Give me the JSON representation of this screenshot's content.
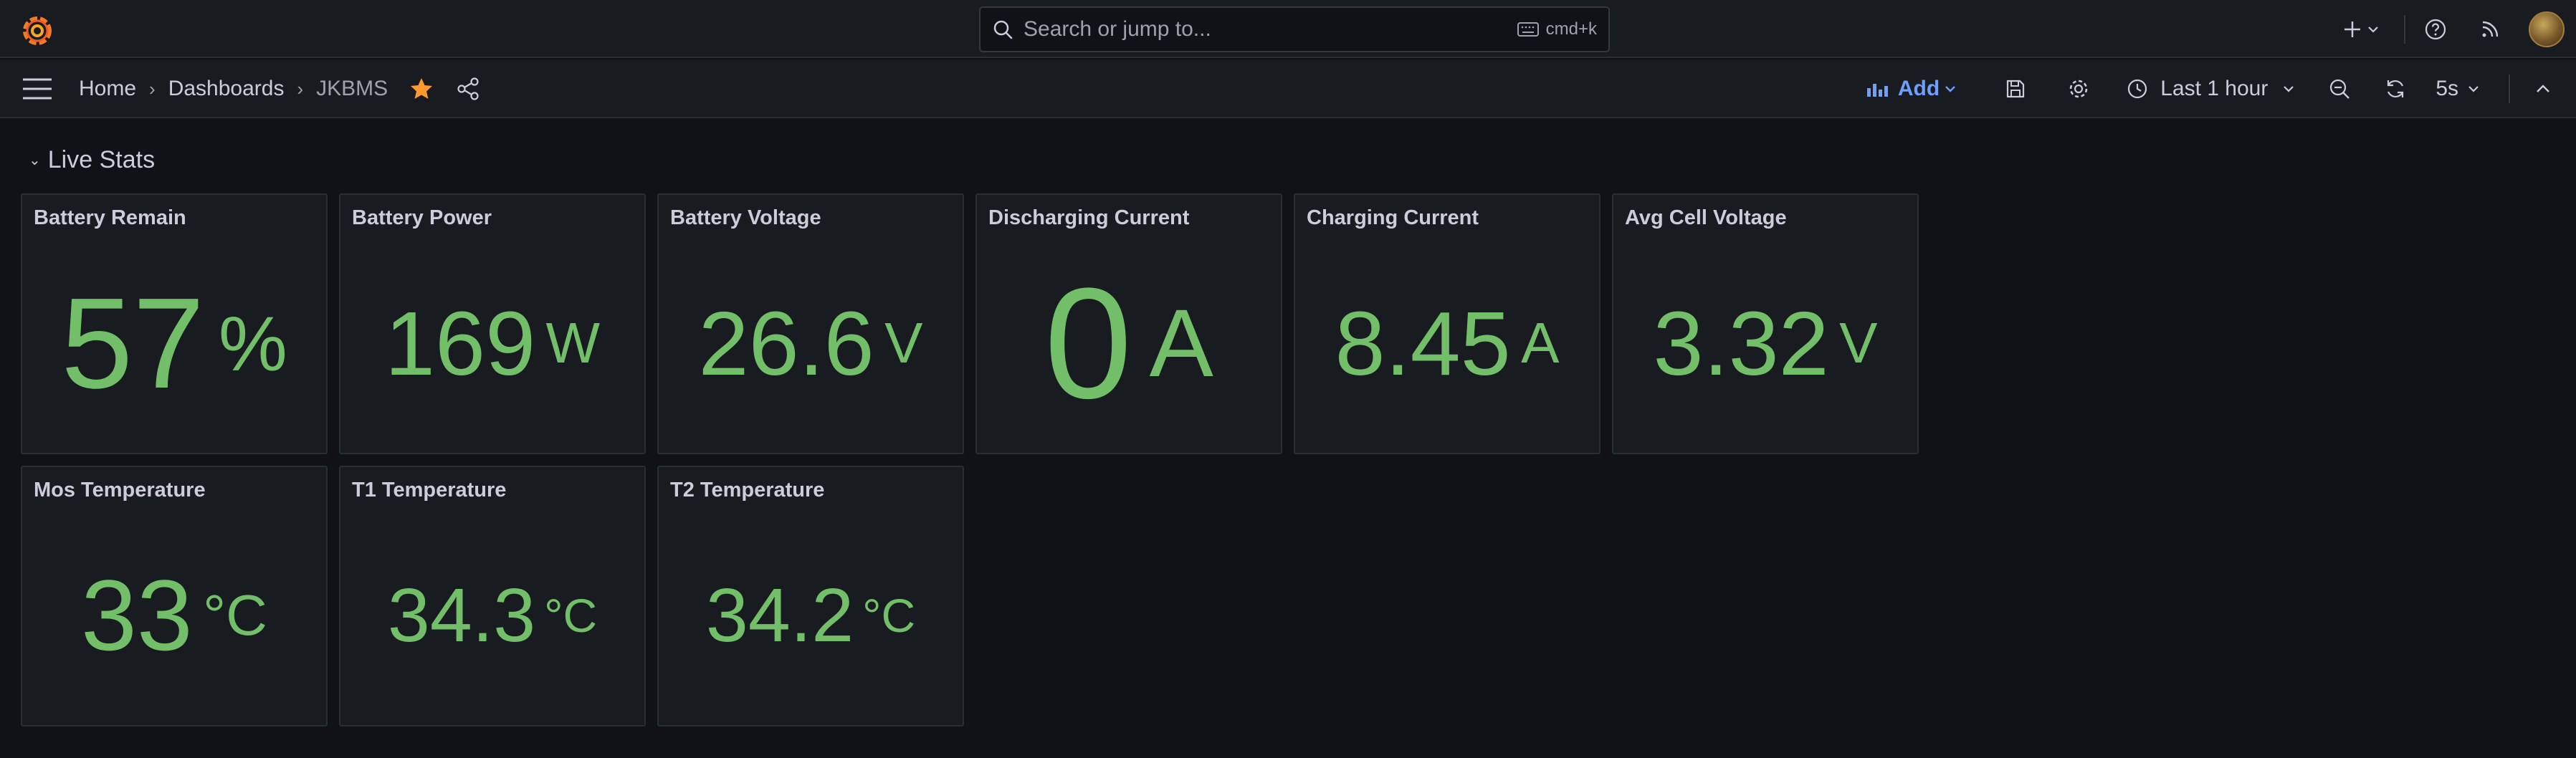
{
  "topbar": {
    "search_placeholder": "Search or jump to...",
    "shortcut": "cmd+k"
  },
  "navbar": {
    "breadcrumbs": [
      "Home",
      "Dashboards",
      "JKBMS"
    ],
    "add_label": "Add",
    "time_range": "Last 1 hour",
    "refresh_interval": "5s"
  },
  "row": {
    "title": "Live Stats"
  },
  "panels": [
    {
      "title": "Battery Remain",
      "value": "57",
      "unit": "%"
    },
    {
      "title": "Battery Power",
      "value": "169",
      "unit": "W"
    },
    {
      "title": "Battery Voltage",
      "value": "26.6",
      "unit": "V"
    },
    {
      "title": "Discharging Current",
      "value": "0",
      "unit": "A"
    },
    {
      "title": "Charging Current",
      "value": "8.45",
      "unit": "A"
    },
    {
      "title": "Avg Cell Voltage",
      "value": "3.32",
      "unit": "V"
    },
    {
      "title": "Mos Temperature",
      "value": "33",
      "unit": "°C"
    },
    {
      "title": "T1 Temperature",
      "value": "34.3",
      "unit": "°C"
    },
    {
      "title": "T2 Temperature",
      "value": "34.2",
      "unit": "°C"
    }
  ],
  "colors": {
    "background": "#111217",
    "panel": "#181b1f",
    "stat_value": "#73bf69",
    "accent": "#6e9fff",
    "star": "#ff9830"
  },
  "icons": {
    "logo": "grafana-logo-icon",
    "search": "search-icon",
    "keyboard": "keyboard-icon",
    "plus": "plus-icon",
    "help": "help-circle-icon",
    "news": "rss-icon",
    "menu": "hamburger-menu-icon",
    "star": "star-icon",
    "share": "share-icon",
    "add": "add-panel-icon",
    "save": "save-icon",
    "settings": "gear-icon",
    "clock": "clock-icon",
    "zoom_out": "zoom-out-icon",
    "refresh": "refresh-icon",
    "collapse": "chevron-up-icon"
  }
}
